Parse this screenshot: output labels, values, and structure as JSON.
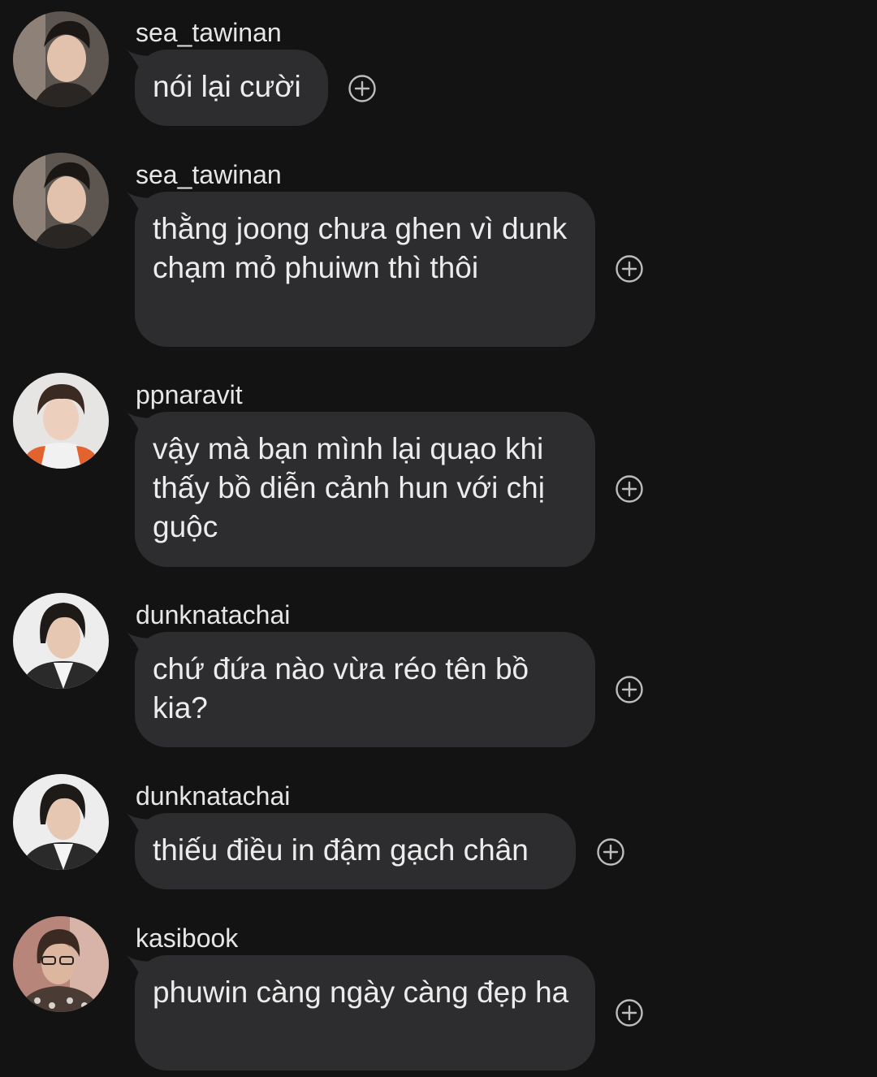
{
  "messages": [
    {
      "username": "sea_tawinan",
      "text": "nói lại cười",
      "avatar": "avatar-sea-tawinan"
    },
    {
      "username": "sea_tawinan",
      "text": "thằng joong chưa ghen vì dunk chạm mỏ phuiwn thì thôi",
      "avatar": "avatar-sea-tawinan"
    },
    {
      "username": "ppnaravit",
      "text": "vậy mà bạn mình lại quạo khi thấy bồ diễn cảnh hun với chị guộc",
      "avatar": "avatar-ppnaravit"
    },
    {
      "username": "dunknatachai",
      "text": "chứ đứa nào vừa réo tên bồ kia?",
      "avatar": "avatar-dunknatachai"
    },
    {
      "username": "dunknatachai",
      "text": "thiếu điều in đậm gạch chân",
      "avatar": "avatar-dunknatachai"
    },
    {
      "username": "kasibook",
      "text": "phuwin càng ngày càng đẹp ha",
      "avatar": "avatar-kasibook"
    }
  ],
  "icons": {
    "react": "add-reaction-icon"
  },
  "colors": {
    "background": "#131313",
    "bubble": "#2d2d2f",
    "text": "#ececec",
    "icon": "#bdbdbd"
  }
}
